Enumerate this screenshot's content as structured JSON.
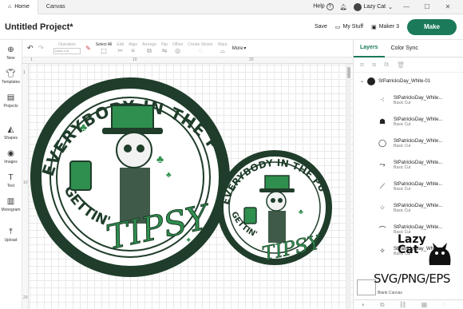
{
  "window": {
    "tabs": [
      {
        "label": "Home"
      },
      {
        "label": "Canvas"
      }
    ],
    "help_label": "Help",
    "user_name": "Lazy Cat"
  },
  "header": {
    "project_title": "Untitled Project*",
    "save_label": "Save",
    "my_stuff_label": "My Stuff",
    "machine_label": "Maker 3",
    "make_label": "Make"
  },
  "toolbar": {
    "operation_label": "Operation",
    "operation_value": "Basic Cut",
    "select_all_label": "Select All",
    "edit_label": "Edit",
    "align_label": "Align",
    "arrange_label": "Arrange",
    "flip_label": "Flip",
    "offset_label": "Offset",
    "create_sticker_label": "Create Sticker",
    "warp_label": "Warp",
    "more_label": "More"
  },
  "leftnav": {
    "items": [
      {
        "label": "New",
        "icon": "plus-icon"
      },
      {
        "label": "Templates",
        "icon": "shirt-icon"
      },
      {
        "label": "Projects",
        "icon": "projects-icon"
      },
      {
        "label": "Shapes",
        "icon": "shapes-icon"
      },
      {
        "label": "Images",
        "icon": "images-icon"
      },
      {
        "label": "Text",
        "icon": "text-icon"
      },
      {
        "label": "Monogram",
        "icon": "monogram-icon"
      },
      {
        "label": "Upload",
        "icon": "upload-icon"
      }
    ]
  },
  "ruler": {
    "top": [
      "1",
      "10",
      "20"
    ],
    "left": [
      "1",
      "10",
      "20"
    ]
  },
  "design": {
    "arc_top": "EVERYBODY IN THE PUB",
    "arc_bottom": "GETTIN'",
    "script": "TIPSY"
  },
  "panel": {
    "tabs": [
      {
        "label": "Layers"
      },
      {
        "label": "Color Sync"
      }
    ],
    "group_name": "StPatricksDay_White-01",
    "layers": [
      {
        "name": "StPatricksDay_White...",
        "op": "Basic Cut"
      },
      {
        "name": "StPatricksDay_White...",
        "op": "Basic Cut"
      },
      {
        "name": "StPatricksDay_White...",
        "op": "Basic Cut"
      },
      {
        "name": "StPatricksDay_White...",
        "op": "Basic Cut"
      },
      {
        "name": "StPatricksDay_White...",
        "op": "Basic Cut"
      },
      {
        "name": "StPatricksDay_White...",
        "op": "Basic Cut"
      },
      {
        "name": "StPatricksDay_White...",
        "op": "Basic Cut"
      },
      {
        "name": "StPatricksDay_White...",
        "op": "Basic Cut"
      }
    ],
    "blank_canvas_label": "Blank Canvas"
  },
  "watermark": {
    "brand_line1": "Lazy",
    "brand_line2": "Cat",
    "formats": "SVG/PNG/EPS"
  },
  "colors": {
    "accent": "#1a7a5a",
    "design_green": "#2f8f4e",
    "design_dark": "#1f3d2a"
  }
}
